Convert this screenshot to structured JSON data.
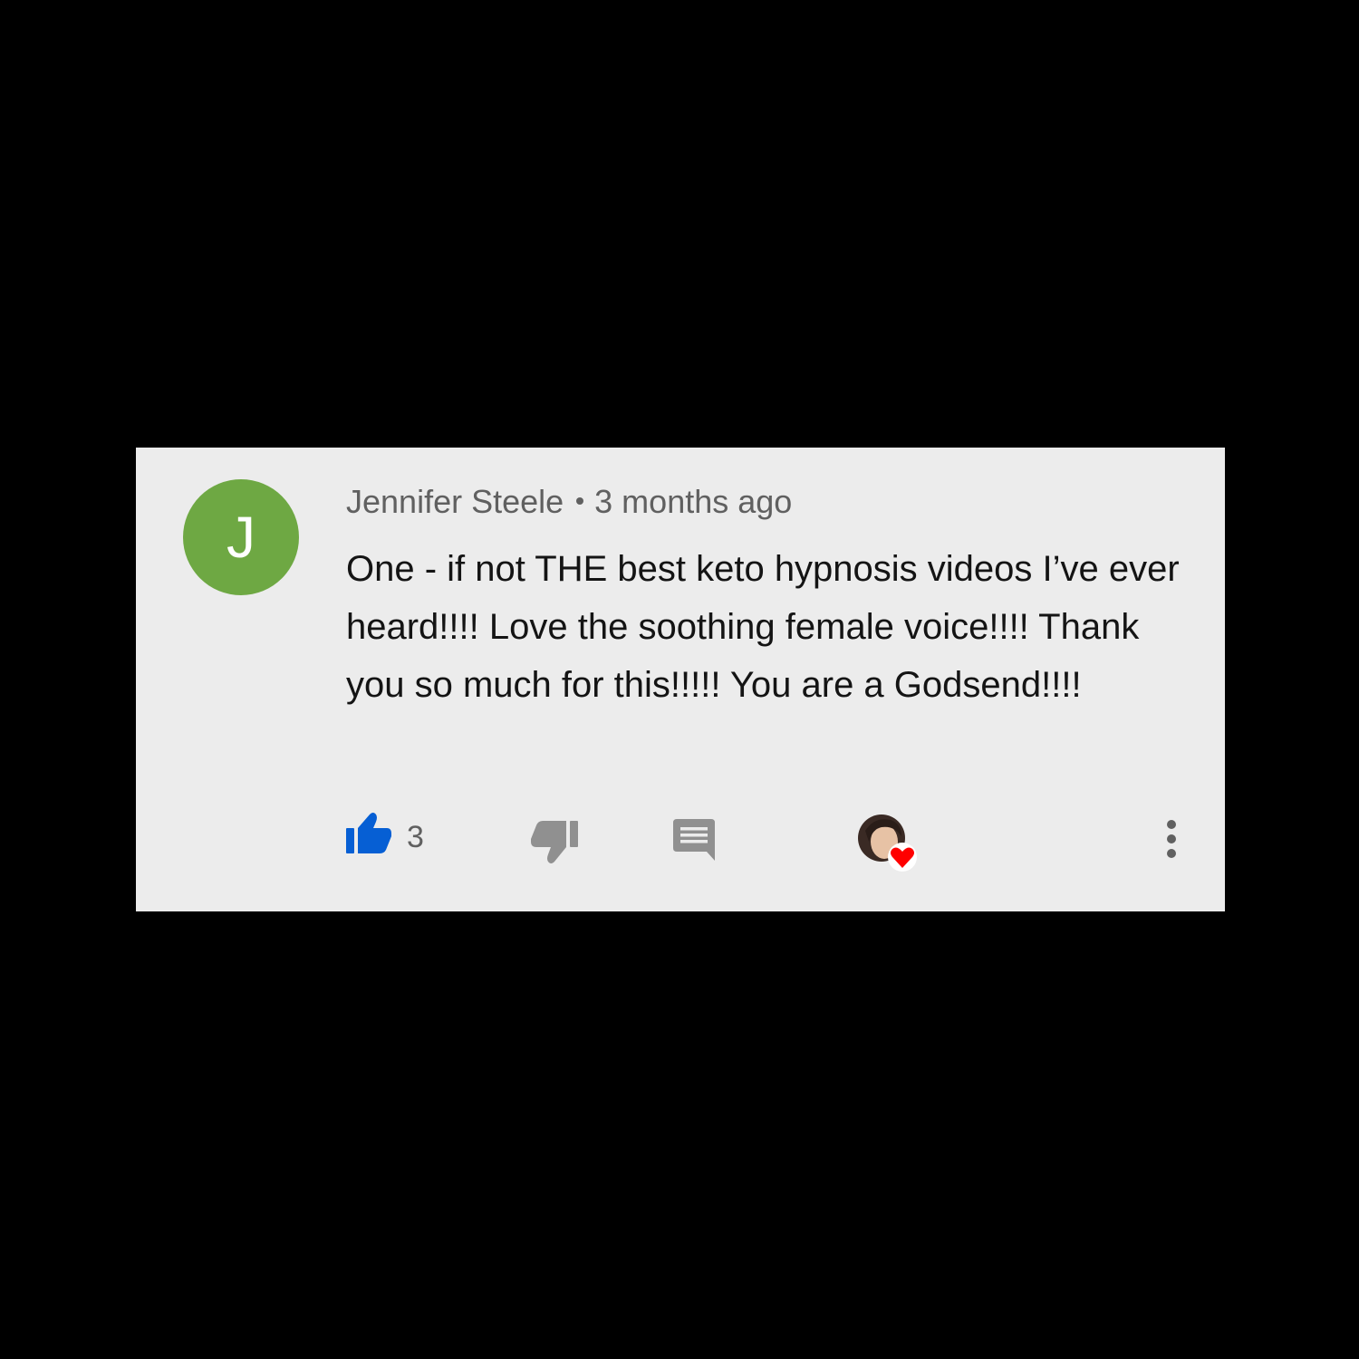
{
  "comment": {
    "avatar_letter": "J",
    "avatar_color": "#6ea843",
    "author": "Jennifer Steele",
    "time": "3 months ago",
    "text": "One - if not THE best keto hypnosis videos I’ve ever heard!!!! Love the soothing female voice!!!! Thank you so much for this!!!!! You are a Godsend!!!!",
    "like_count": "3",
    "like_active_color": "#065fd4",
    "icons": {
      "like": "thumbs-up-icon",
      "dislike": "thumbs-down-icon",
      "reply": "reply-comment-icon",
      "creator_heart": "creator-heart-icon",
      "more": "more-vertical-icon"
    }
  }
}
